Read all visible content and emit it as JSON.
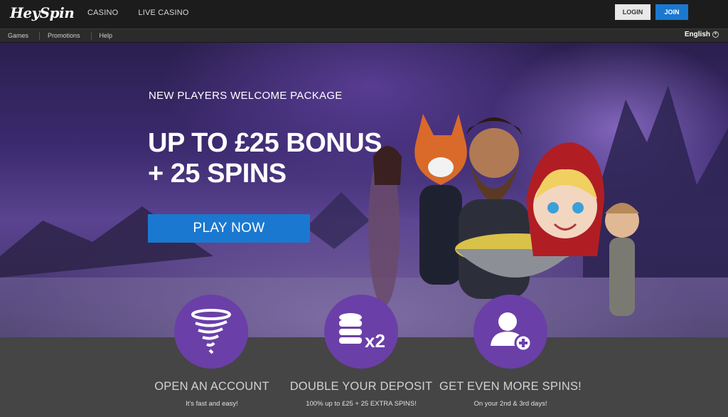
{
  "header": {
    "logo": "HeySpin",
    "nav": [
      "CASINO",
      "LIVE CASINO"
    ],
    "login_label": "LOGIN",
    "join_label": "JOIN"
  },
  "subnav": {
    "items": [
      "Games",
      "Promotions",
      "Help"
    ],
    "language": "English"
  },
  "hero": {
    "subtitle": "NEW PLAYERS WELCOME PACKAGE",
    "title_line1": "UP TO £25 BONUS",
    "title_line2": "+ 25 SPINS",
    "cta_label": "PLAY NOW"
  },
  "steps": [
    {
      "icon": "tornado-icon",
      "title": "OPEN AN ACCOUNT",
      "desc": "It's fast and easy!"
    },
    {
      "icon": "coins-x2-icon",
      "title": "DOUBLE YOUR DEPOSIT",
      "desc": "100% up to £25 + 25 EXTRA SPINS!"
    },
    {
      "icon": "add-user-icon",
      "title": "GET EVEN MORE SPINS!",
      "desc": "On your 2nd & 3rd days!"
    }
  ],
  "colors": {
    "accent_blue": "#1b78d0",
    "icon_purple": "#6b3fa8",
    "header_bg": "#1c1c1c"
  }
}
